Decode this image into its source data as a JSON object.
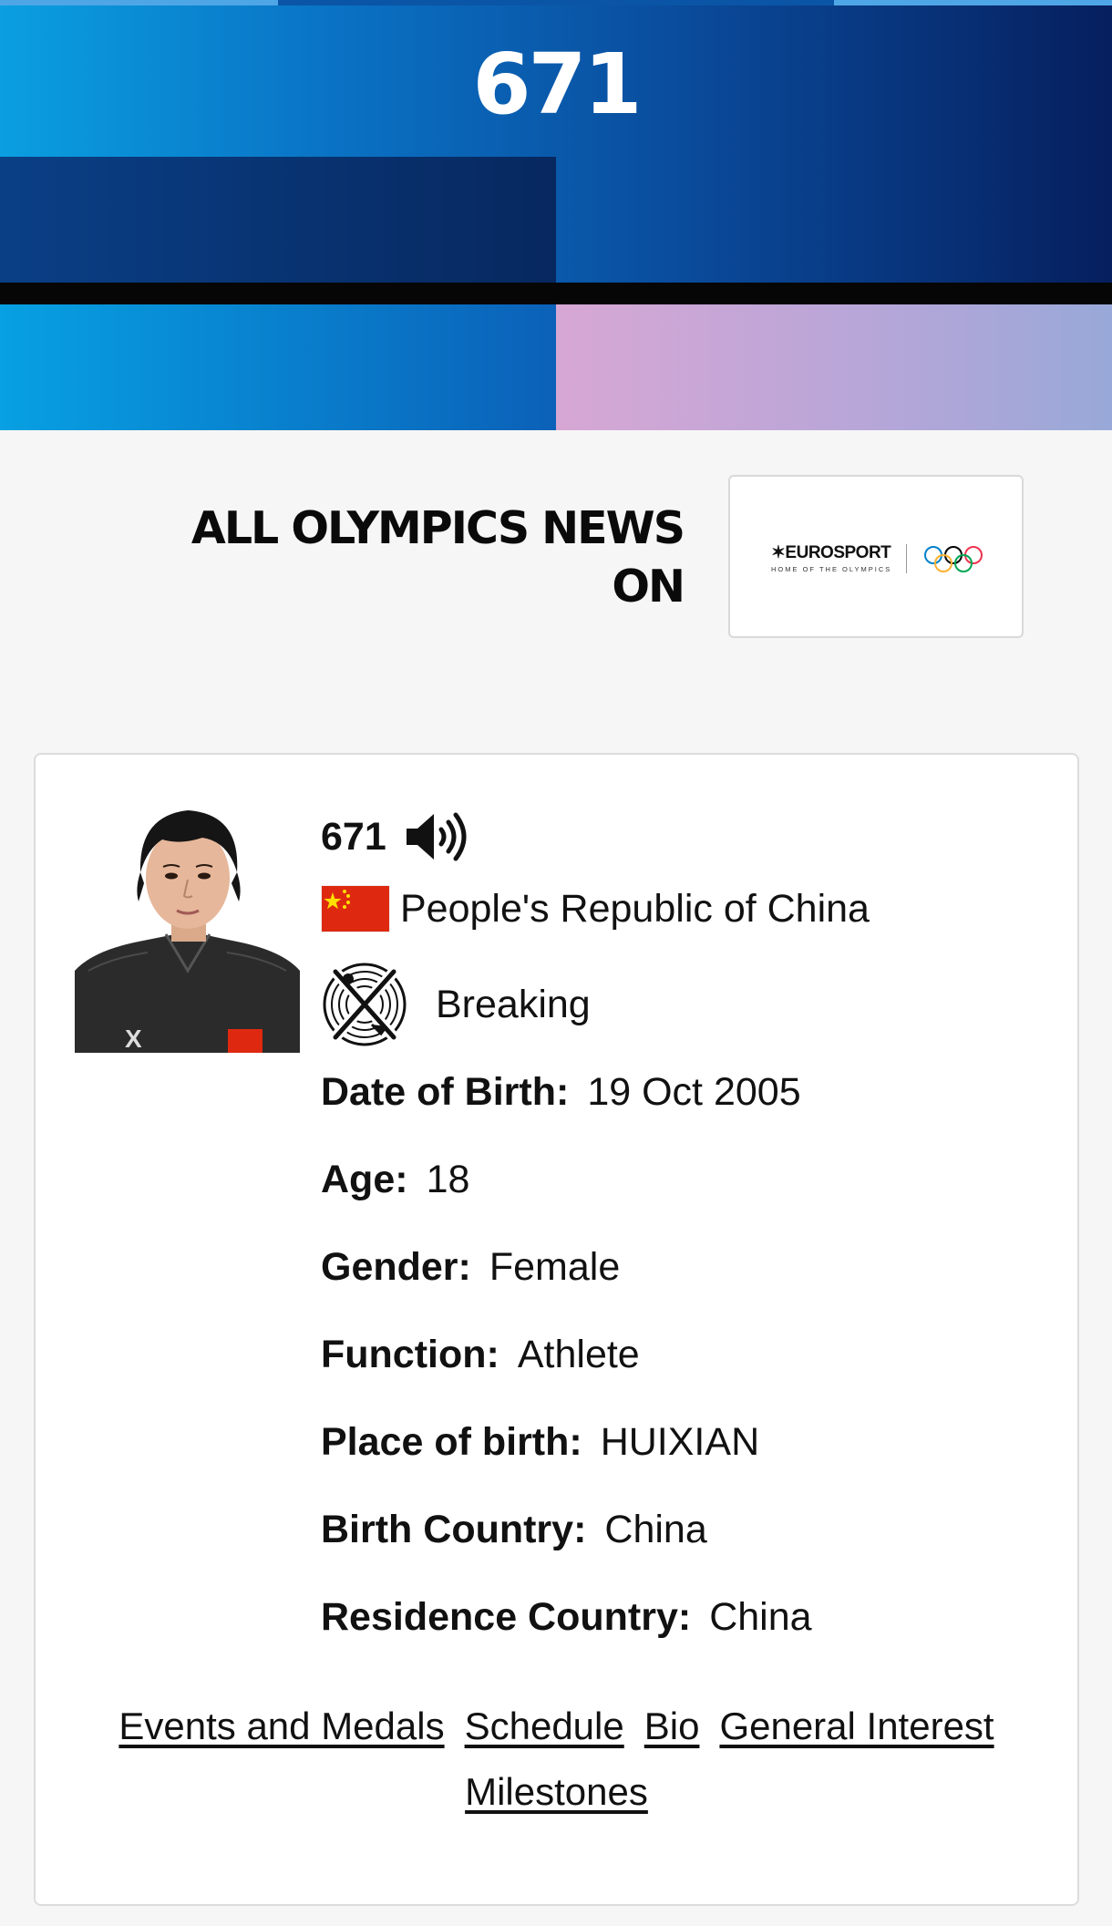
{
  "hero": {
    "title": "671"
  },
  "promo": {
    "line1": "ALL OLYMPICS NEWS",
    "line2": "ON",
    "logo_brand": "EUROSPORT",
    "logo_tagline": "HOME OF THE OLYMPICS"
  },
  "athlete": {
    "name": "671",
    "country": "People's Republic of China",
    "sport": "Breaking",
    "details": [
      {
        "label": "Date of Birth:",
        "value": "19 Oct 2005"
      },
      {
        "label": "Age:",
        "value": "18"
      },
      {
        "label": "Gender:",
        "value": "Female"
      },
      {
        "label": "Function:",
        "value": "Athlete"
      },
      {
        "label": "Place of birth:",
        "value": "HUIXIAN"
      },
      {
        "label": "Birth Country:",
        "value": "China"
      },
      {
        "label": "Residence Country:",
        "value": "China"
      }
    ]
  },
  "links": {
    "events": "Events and Medals",
    "schedule": "Schedule",
    "bio": "Bio",
    "general": "General Interest",
    "milestones": "Milestones"
  },
  "icons": {
    "speaker": "speaker-icon",
    "flag": "china-flag-icon",
    "sport": "breaking-pictogram-icon"
  },
  "colors": {
    "hero_blue": "#0a72c4",
    "hero_navy": "#061f5e",
    "hero_pink": "#d7a7d4",
    "flag_red": "#de2910",
    "flag_star": "#ffde00"
  }
}
